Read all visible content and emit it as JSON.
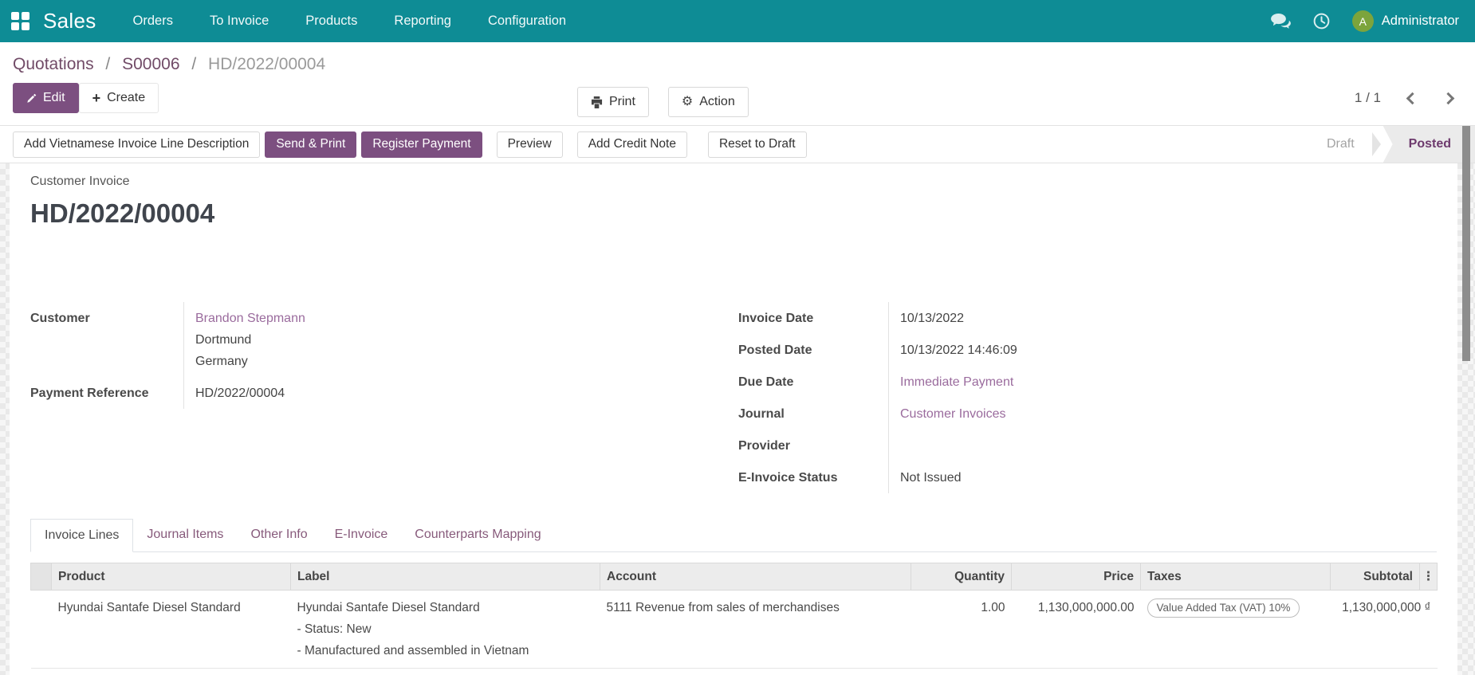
{
  "navbar": {
    "brand": "Sales",
    "menus": [
      "Orders",
      "To Invoice",
      "Products",
      "Reporting",
      "Configuration"
    ],
    "user_name": "Administrator",
    "avatar_initial": "A"
  },
  "colors": {
    "navbar_bg": "#0e8c95",
    "primary_button": "#7c4f80",
    "link": "#9a6b9d",
    "avatar_bg": "#7ca43c",
    "status_active_text": "#6d3a6d"
  },
  "breadcrumb": {
    "quotations": "Quotations",
    "sep": "/",
    "order": "S00006",
    "current": "HD/2022/00004"
  },
  "controls": {
    "edit": "Edit",
    "create": "Create",
    "print": "Print",
    "action": "Action",
    "pager": "1 / 1"
  },
  "statusbar": {
    "add_vn_desc": "Add Vietnamese Invoice Line Description",
    "send_print": "Send & Print",
    "register_payment": "Register Payment",
    "preview": "Preview",
    "add_credit_note": "Add Credit Note",
    "reset_to_draft": "Reset to Draft",
    "state_draft": "Draft",
    "state_posted": "Posted"
  },
  "invoice": {
    "type_label": "Customer Invoice",
    "number": "HD/2022/00004",
    "customer_label": "Customer",
    "customer_name": "Brandon Stepmann",
    "customer_city": "Dortmund",
    "customer_country": "Germany",
    "payment_ref_label": "Payment Reference",
    "payment_ref": "HD/2022/00004",
    "invoice_date_label": "Invoice Date",
    "invoice_date": "10/13/2022",
    "posted_date_label": "Posted Date",
    "posted_date": "10/13/2022 14:46:09",
    "due_date_label": "Due Date",
    "due_date": "Immediate Payment",
    "journal_label": "Journal",
    "journal": "Customer Invoices",
    "provider_label": "Provider",
    "provider": "",
    "einvoice_status_label": "E-Invoice Status",
    "einvoice_status": "Not Issued"
  },
  "tabs": [
    "Invoice Lines",
    "Journal Items",
    "Other Info",
    "E-Invoice",
    "Counterparts Mapping"
  ],
  "table": {
    "headers": {
      "product": "Product",
      "label": "Label",
      "account": "Account",
      "quantity": "Quantity",
      "price": "Price",
      "taxes": "Taxes",
      "subtotal": "Subtotal"
    },
    "kebab": "⋮",
    "row": {
      "product": "Hyundai Santafe Diesel Standard",
      "label_lines": [
        "Hyundai Santafe Diesel Standard",
        "- Status: New",
        "- Manufactured and assembled in Vietnam"
      ],
      "account": "5111 Revenue from sales of merchandises",
      "quantity": "1.00",
      "price": "1,130,000,000.00",
      "taxes": "Value Added Tax (VAT) 10%",
      "subtotal": "1,130,000,000 ₫"
    }
  }
}
